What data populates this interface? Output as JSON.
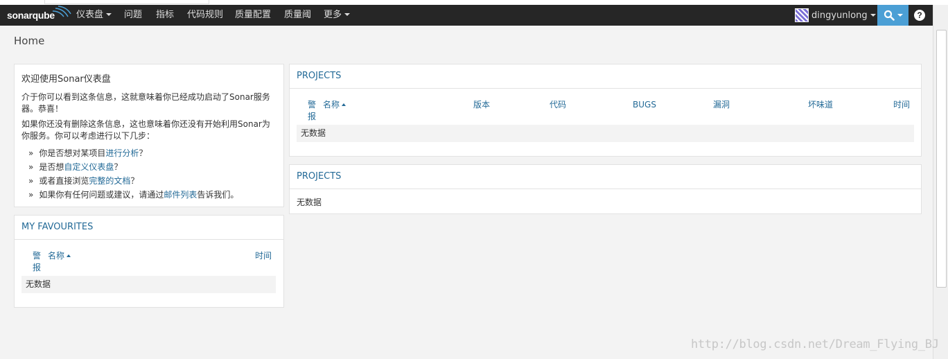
{
  "nav": {
    "logo_text": "sonarqube",
    "items": [
      {
        "label": "仪表盘",
        "dropdown": true
      },
      {
        "label": "问题",
        "dropdown": false
      },
      {
        "label": "指标",
        "dropdown": false
      },
      {
        "label": "代码规则",
        "dropdown": false
      },
      {
        "label": "质量配置",
        "dropdown": false
      },
      {
        "label": "质量阈",
        "dropdown": false
      },
      {
        "label": "更多",
        "dropdown": true
      }
    ],
    "user": "dingyunlong",
    "help": "?"
  },
  "page": {
    "title": "Home"
  },
  "welcome": {
    "title": "欢迎使用Sonar仪表盘",
    "p1": "介于你可以看到这条信息，这就意味着你已经成功启动了Sonar服务器。恭喜！",
    "p2": "如果你还没有删除这条信息，这也意味着你还没有开始利用Sonar为你服务。你可以考虑进行以下几步：",
    "bullet": "»",
    "items": [
      {
        "before": "你是否想对某项目",
        "link": "进行分析",
        "after": "？"
      },
      {
        "before": "是否想",
        "link": "自定义仪表盘",
        "after": "？"
      },
      {
        "before": "或者直接浏览",
        "link": "完整的文档",
        "after": "？"
      },
      {
        "before": "如果你有任何问题或建议，请通过",
        "link": "邮件列表",
        "after": "告诉我们。"
      }
    ]
  },
  "favourites": {
    "title": "MY FAVOURITES",
    "columns": {
      "alert_line1": "警",
      "alert_line2": "报",
      "name": "名称",
      "time": "时间"
    },
    "empty": "无数据"
  },
  "projects1": {
    "title": "PROJECTS",
    "columns": {
      "alert_line1": "警",
      "alert_line2": "报",
      "name": "名称",
      "version": "版本",
      "code": "代码",
      "bugs": "BUGS",
      "vulns": "漏洞",
      "smells": "坏味道",
      "time": "时间"
    },
    "empty": "无数据"
  },
  "projects2": {
    "title": "PROJECTS",
    "empty": "无数据"
  },
  "watermark": "http://blog.csdn.net/Dream_Flying_BJ",
  "colors": {
    "navbar": "#262626",
    "accent": "#4b9fd5",
    "link": "#236a97",
    "background": "#f3f3f3"
  }
}
